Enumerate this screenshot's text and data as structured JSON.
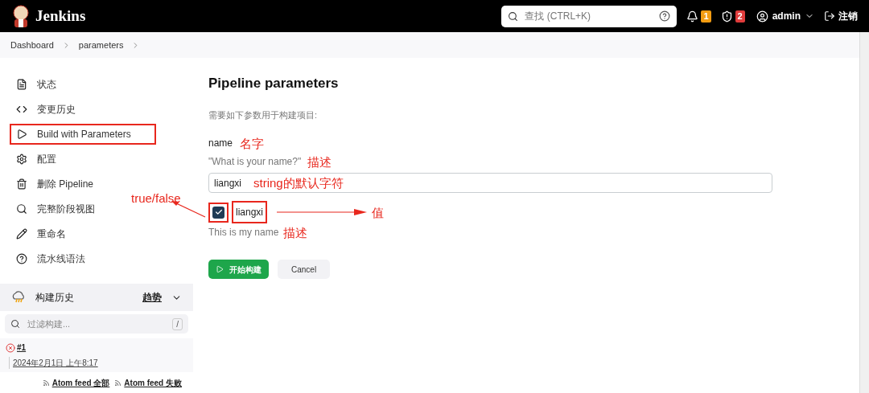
{
  "header": {
    "logo_text": "Jenkins",
    "search": {
      "placeholder": "查找 (CTRL+K)"
    },
    "notifications": "1",
    "security": "2",
    "user": "admin",
    "logout": "注销"
  },
  "breadcrumb": [
    "Dashboard",
    "parameters"
  ],
  "sidebar": {
    "items": [
      {
        "label": "状态",
        "highlighted": false
      },
      {
        "label": "变更历史",
        "highlighted": false
      },
      {
        "label": "Build with Parameters",
        "highlighted": true
      },
      {
        "label": "配置",
        "highlighted": false
      },
      {
        "label": "删除 Pipeline",
        "highlighted": false
      },
      {
        "label": "完整阶段视图",
        "highlighted": false
      },
      {
        "label": "重命名",
        "highlighted": false
      },
      {
        "label": "流水线语法",
        "highlighted": false
      }
    ]
  },
  "build_history": {
    "title": "构建历史",
    "trend": "趋势",
    "filter": {
      "placeholder": "过滤构建...",
      "shortcut": "/"
    },
    "builds": [
      {
        "number": "#1",
        "date": "2024年2月1日 上午8:17",
        "failed": true
      }
    ],
    "feeds": [
      "Atom feed 全部",
      "Atom feed 失败"
    ]
  },
  "main": {
    "title": "Pipeline parameters",
    "intro": "需要如下参数用于构建项目:",
    "parameters": [
      {
        "kind": "string",
        "name": "name",
        "name_note": "名字",
        "description": "\"What is your name?\"",
        "description_note": "描述",
        "value": "liangxi",
        "value_note": "string的默认字符"
      },
      {
        "kind": "boolean",
        "name": "liangxi",
        "checked": true,
        "highlighted": true,
        "check_note": "true/false",
        "name_note": "值",
        "description": "This is my name",
        "description_note": "描述"
      }
    ],
    "buttons": {
      "build": "开始构建",
      "cancel": "Cancel"
    }
  }
}
